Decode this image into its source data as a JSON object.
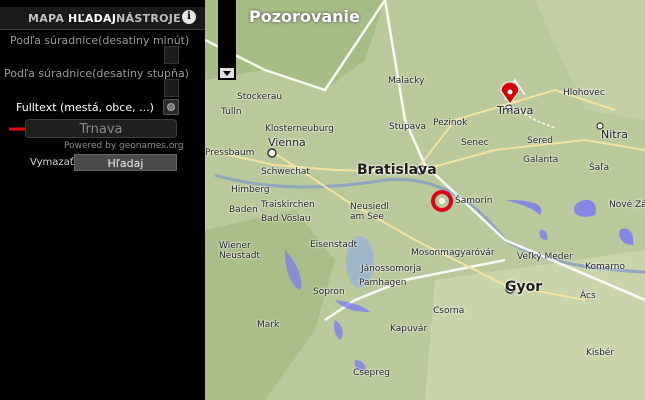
{
  "tabs": [
    {
      "label": "MAPA"
    },
    {
      "label": "HĽADAJ"
    },
    {
      "label": "NÁSTROJE"
    }
  ],
  "info_icon": "i",
  "search": {
    "coord_minutes_label": "Podľa súradnice(desatiny minút)",
    "coord_degrees_label": "Podľa súradnice(desatiny stupňa)",
    "fulltext_label": "Fulltext (mestá, obce, ...)",
    "query": "Trnava",
    "powered_by": "Powered by geonames.org",
    "clear_label": "Vymazať",
    "submit_label": "Hľadaj"
  },
  "map": {
    "title": "Pozorovanie",
    "labels": {
      "vienna": "Vienna",
      "bratislava": "Bratislava",
      "gyor": "Gyor",
      "trnava": "Trnava",
      "nitra": "Nitra",
      "malacky": "Malacky",
      "hlohovec": "Hlohovec",
      "stupava": "Stupava",
      "pezinok": "Pezinok",
      "senec": "Senec",
      "sered": "Sered",
      "galanta": "Galanta",
      "sala": "Šaľa",
      "samorin": "Šamorín",
      "velky_meder": "Veľký Meder",
      "komarno": "Komarno",
      "acs": "Ács",
      "kisber": "Kisbér",
      "nove_zamky": "Nové Zámky",
      "tulln": "Tulln",
      "stockerau": "Stockerau",
      "klosterneuburg": "Klosterneuburg",
      "pressbaum": "Pressbaum",
      "schwechat": "Schwechat",
      "himberg": "Himberg",
      "traiskirchen": "Traiskirchen",
      "baden": "Baden",
      "bad_voslau": "Bad Vöslau",
      "neusiedl": "Neusiedl am See",
      "wiener_neustadt": "Wiener Neustadt",
      "eisenstadt": "Eisenstadt",
      "janossomorja": "Jánossomorja",
      "mosonmagyarovar": "Mosonmagyaróvár",
      "pamhagen": "Pamhagen",
      "sopron": "Sopron",
      "csorna": "Csorna",
      "kapuvar": "Kapuvár",
      "csepreg": "Csepreg",
      "mark": "Mark"
    }
  }
}
